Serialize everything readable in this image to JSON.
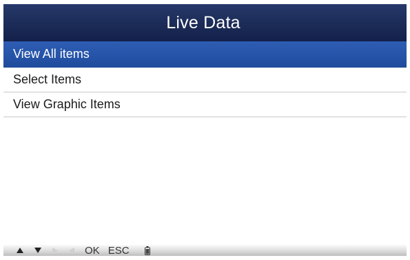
{
  "header": {
    "title": "Live Data"
  },
  "menu": {
    "items": [
      {
        "label": "View All items",
        "selected": true
      },
      {
        "label": "Select Items",
        "selected": false
      },
      {
        "label": "View Graphic Items",
        "selected": false
      }
    ]
  },
  "footer": {
    "keys": [
      {
        "icon": "up-arrow-icon",
        "enabled": true
      },
      {
        "icon": "down-arrow-icon",
        "enabled": true
      },
      {
        "icon": "right-arrow-icon",
        "enabled": false
      },
      {
        "icon": "left-arrow-icon",
        "enabled": false
      }
    ],
    "ok_label": "OK",
    "esc_label": "ESC",
    "battery_icon": "battery-icon"
  },
  "colors": {
    "title_bar": "#1c2b57",
    "selected_row": "#2553a8",
    "text": "#1b1b1b"
  }
}
